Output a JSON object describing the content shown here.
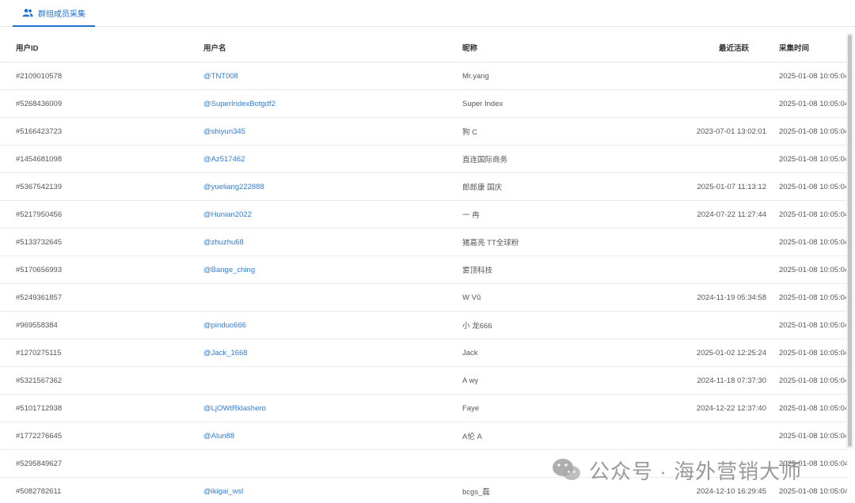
{
  "tabs": [
    {
      "label": "群组成员采集",
      "active": true
    }
  ],
  "table": {
    "headers": {
      "id": "用户ID",
      "username": "用户名",
      "nickname": "昵称",
      "last_active": "最近活跃",
      "collected": "采集时间"
    },
    "rows": [
      {
        "id": "#2109010578",
        "username": "@TNT008",
        "nickname": "Mr.yang",
        "last_active": "",
        "collected": "2025-01-08 10:05:04"
      },
      {
        "id": "#5268436009",
        "username": "@SuperIndexBotgdf2",
        "nickname": "Super Index",
        "last_active": "",
        "collected": "2025-01-08 10:05:04"
      },
      {
        "id": "#5166423723",
        "username": "@shiyun345",
        "nickname": "狗 C",
        "last_active": "2023-07-01 13:02:01",
        "collected": "2025-01-08 10:05:04"
      },
      {
        "id": "#1454681098",
        "username": "@Az517462",
        "nickname": "直连国际商务",
        "last_active": "",
        "collected": "2025-01-08 10:05:04"
      },
      {
        "id": "#5367542139",
        "username": "@yueliang222888",
        "nickname": "郎郎康 国庆",
        "last_active": "2025-01-07 11:13:12",
        "collected": "2025-01-08 10:05:04"
      },
      {
        "id": "#5217950456",
        "username": "@Hunian2022",
        "nickname": "一 冉",
        "last_active": "2024-07-22 11:27:44",
        "collected": "2025-01-08 10:05:04"
      },
      {
        "id": "#5133732645",
        "username": "@zhuzhu68",
        "nickname": "猪嘉亮 TT全球粉",
        "last_active": "",
        "collected": "2025-01-08 10:05:04"
      },
      {
        "id": "#5170656993",
        "username": "@Bange_ching",
        "nickname": "雾顶科技",
        "last_active": "",
        "collected": "2025-01-08 10:05:04"
      },
      {
        "id": "#5249361857",
        "username": "",
        "nickname": "W Vũ",
        "last_active": "2024-11-19 05:34:58",
        "collected": "2025-01-08 10:05:04"
      },
      {
        "id": "#969558384",
        "username": "@pinduo666",
        "nickname": "小 龙666",
        "last_active": "",
        "collected": "2025-01-08 10:05:04"
      },
      {
        "id": "#1270275115",
        "username": "@Jack_1668",
        "nickname": "Jack",
        "last_active": "2025-01-02 12:25:24",
        "collected": "2025-01-08 10:05:04"
      },
      {
        "id": "#5321567362",
        "username": "",
        "nickname": "A wy",
        "last_active": "2024-11-18 07:37:30",
        "collected": "2025-01-08 10:05:04"
      },
      {
        "id": "#5101712938",
        "username": "@LjOWtRklashero",
        "nickname": "Faye",
        "last_active": "2024-12-22 12:37:40",
        "collected": "2025-01-08 10:05:04"
      },
      {
        "id": "#1772276645",
        "username": "@Alun88",
        "nickname": "A伦 A",
        "last_active": "",
        "collected": "2025-01-08 10:05:04"
      },
      {
        "id": "#5295849627",
        "username": "",
        "nickname": "",
        "last_active": "",
        "collected": "2025-01-08 10:05:04"
      },
      {
        "id": "#5082782611",
        "username": "@ikigai_wsl",
        "nickname": "bcgs_磊",
        "last_active": "2024-12-10 16:29:45",
        "collected": "2025-01-08 10:05:04"
      }
    ]
  },
  "watermark": {
    "text": "公众号 · 海外营销大师"
  },
  "colors": {
    "accent": "#1f6fd0",
    "link": "#2f7bd6"
  }
}
